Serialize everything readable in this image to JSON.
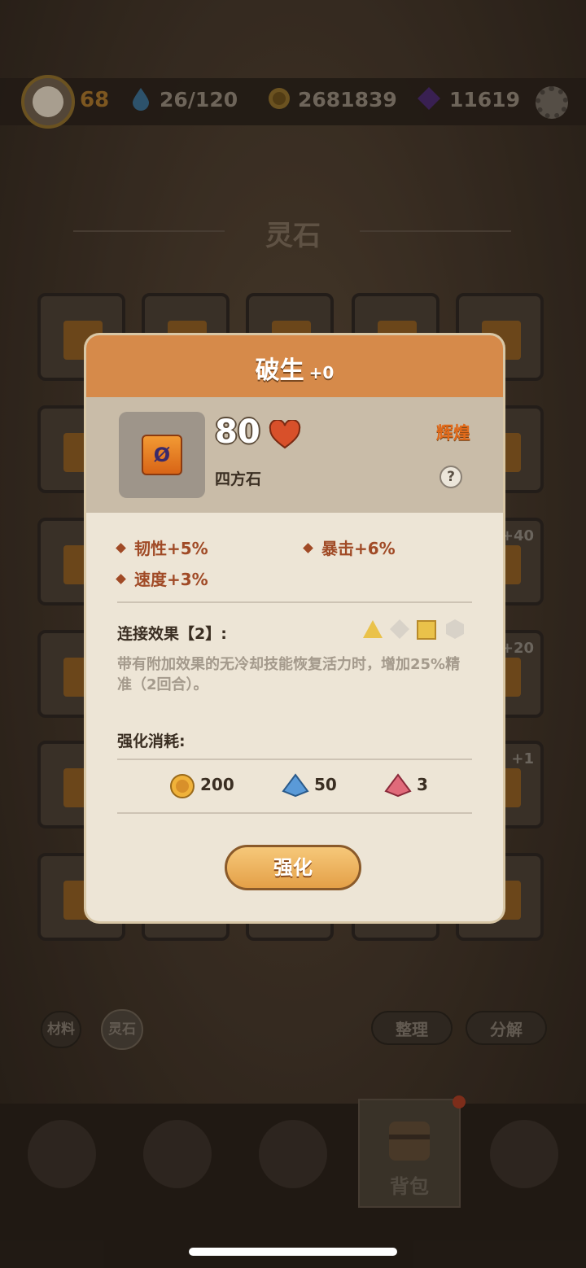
{
  "hud": {
    "level": "68",
    "stamina": "26/120",
    "gold": "2681839",
    "gems": "11619"
  },
  "inventory": {
    "title": "灵石",
    "slot_badges": [
      "+40",
      "+20",
      "+1"
    ],
    "filter_tabs": [
      "材料",
      "灵石"
    ],
    "actions": [
      "整理",
      "分解"
    ]
  },
  "bottom_nav": {
    "active_label": "背包",
    "icons": [
      "device-icon",
      "portal-icon",
      "mountain-icon",
      "backpack-icon",
      "map-pin-icon"
    ]
  },
  "modal": {
    "title": "破生",
    "title_level": "+0",
    "power": "80",
    "item_type": "四方石",
    "rarity": "辉煌",
    "item_glyph": "Ø",
    "help": "?",
    "stats": [
      "韧性+5%",
      "暴击+6%",
      "速度+3%"
    ],
    "link_label": "连接效果【2】:",
    "link_shapes": [
      "triangle-gold",
      "diamond-grey",
      "square-gold",
      "hexagon-grey"
    ],
    "description": "带有附加效果的无冷却技能恢复活力时，增加25%精准（2回合）。",
    "cost_label": "强化消耗:",
    "costs": [
      {
        "icon": "gold-coin-icon",
        "amount": "200"
      },
      {
        "icon": "blue-crystal-icon",
        "amount": "50"
      },
      {
        "icon": "red-crystal-icon",
        "amount": "3"
      }
    ],
    "button_label": "强化"
  },
  "colors": {
    "modal_header": "#d68a4a",
    "stat_text": "#a04a26",
    "rarity": "#e26a1a"
  }
}
